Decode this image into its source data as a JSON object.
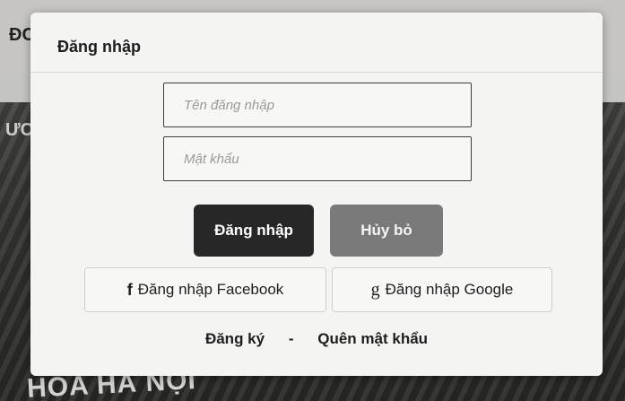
{
  "background": {
    "header_text": "ĐC",
    "banner_left_text": "ƯC",
    "banner_bottom_text": "HOA HÀ NỘI"
  },
  "modal": {
    "title": "Đăng nhập",
    "username_placeholder": "Tên đăng nhập",
    "password_placeholder": "Mật khẩu",
    "login_label": "Đăng nhập",
    "cancel_label": "Hủy bỏ",
    "facebook_icon": "f",
    "facebook_label": "Đăng nhập Facebook",
    "google_icon": "g",
    "google_label": "Đăng nhập Google",
    "register_label": "Đăng ký",
    "separator": "-",
    "forgot_label": "Quên mật khẩu"
  },
  "colors": {
    "primary_button": "#272727",
    "secondary_button": "#7a7a7a",
    "modal_background": "#f4f4f2"
  }
}
